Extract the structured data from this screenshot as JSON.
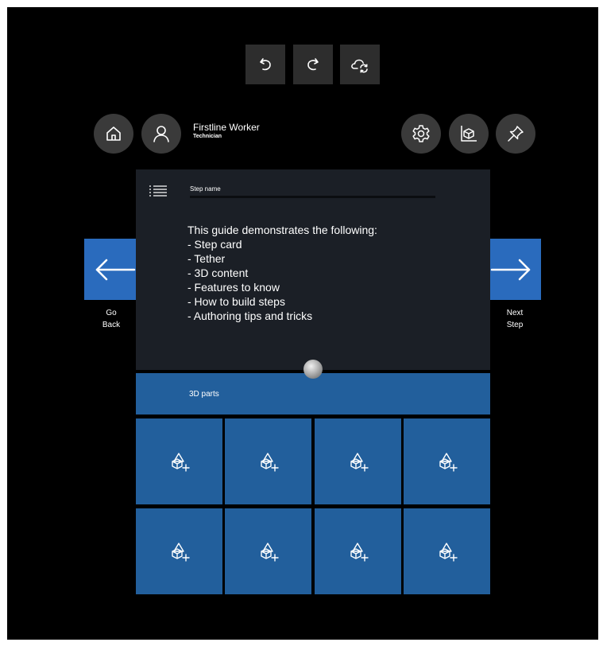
{
  "toolbar": {
    "buttons": [
      {
        "id": "undo",
        "icon": "undo-icon"
      },
      {
        "id": "redo",
        "icon": "redo-icon"
      },
      {
        "id": "sync",
        "icon": "cloud-sync-icon"
      }
    ]
  },
  "header": {
    "left_buttons": [
      {
        "id": "home",
        "icon": "home-icon"
      },
      {
        "id": "profile",
        "icon": "person-icon"
      }
    ],
    "user_name": "Firstline Worker",
    "user_role": "Technician",
    "right_buttons": [
      {
        "id": "settings",
        "icon": "gear-icon"
      },
      {
        "id": "anchor",
        "icon": "anchor-cube-icon"
      },
      {
        "id": "pin",
        "icon": "pin-icon"
      }
    ]
  },
  "step_card": {
    "menu_icon": "list-icon",
    "step_name": "Step name",
    "body": "This guide demonstrates the following:\n- Step card\n- Tether\n- 3D content\n- Features to know\n- How to build steps\n- Authoring tips and tricks"
  },
  "nav": {
    "back_label": "Go\nBack",
    "next_label": "Next\nStep"
  },
  "parts": {
    "title": "3D parts",
    "slots": [
      {
        "icon": "add-3d-part-icon"
      },
      {
        "icon": "add-3d-part-icon"
      },
      {
        "icon": "add-3d-part-icon"
      },
      {
        "icon": "add-3d-part-icon"
      },
      {
        "icon": "add-3d-part-icon"
      },
      {
        "icon": "add-3d-part-icon"
      },
      {
        "icon": "add-3d-part-icon"
      },
      {
        "icon": "add-3d-part-icon"
      }
    ]
  },
  "colors": {
    "background": "#000000",
    "accent_blue": "#2a6bbd",
    "panel_blue": "#225f9c",
    "card_bg": "#1b1f26",
    "button_gray": "#3a3a3a"
  }
}
